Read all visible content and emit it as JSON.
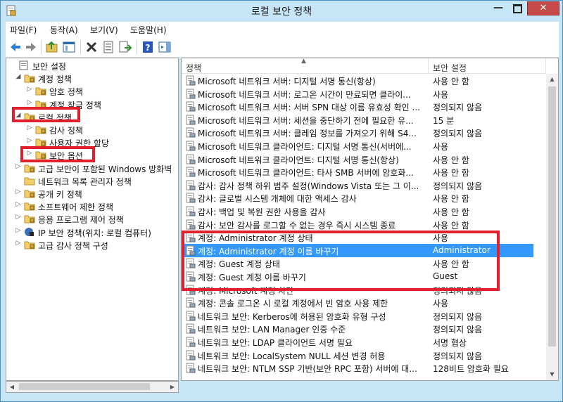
{
  "window": {
    "title": "로컬 보안 정책",
    "min_glyph": "—",
    "close_glyph": "✕"
  },
  "menu": [
    {
      "label": "파일(F)"
    },
    {
      "label": "동작(A)"
    },
    {
      "label": "보기(V)"
    },
    {
      "label": "도움말(H)"
    }
  ],
  "toolbar_icons": [
    "back-icon",
    "forward-icon",
    "up-folder-icon",
    "show-hide-tree-icon",
    "delete-icon",
    "properties-icon",
    "export-list-icon",
    "help-icon",
    "show-hide-action-pane-icon"
  ],
  "tree": [
    {
      "label": "보안 설정",
      "exp": "",
      "icon": "security-settings-icon",
      "level": 0
    },
    {
      "label": "계정 정책",
      "exp": "◢",
      "icon": "folder-icon",
      "level": 1
    },
    {
      "label": "암호 정책",
      "exp": "▷",
      "icon": "folder-icon",
      "level": 2
    },
    {
      "label": "계정 잠금 정책",
      "exp": "▷",
      "icon": "folder-icon",
      "level": 2
    },
    {
      "label": "로컬 정책",
      "exp": "◢",
      "icon": "folder-icon",
      "level": 1
    },
    {
      "label": "감사 정책",
      "exp": "▷",
      "icon": "folder-icon",
      "level": 2
    },
    {
      "label": "사용자 권한 할당",
      "exp": "▷",
      "icon": "folder-icon",
      "level": 2
    },
    {
      "label": "보안 옵션",
      "exp": "▷",
      "icon": "folder-icon",
      "level": 2
    },
    {
      "label": "고급 보안이 포함된 Windows 방화벽",
      "exp": "▷",
      "icon": "folder-icon",
      "level": 1
    },
    {
      "label": "네트워크 목록 관리자 정책",
      "exp": "",
      "icon": "folder-icon",
      "level": 1
    },
    {
      "label": "공개 키 정책",
      "exp": "▷",
      "icon": "folder-icon",
      "level": 1
    },
    {
      "label": "소프트웨어 제한 정책",
      "exp": "▷",
      "icon": "folder-icon",
      "level": 1
    },
    {
      "label": "응용 프로그램 제어 정책",
      "exp": "▷",
      "icon": "folder-icon",
      "level": 1
    },
    {
      "label": "IP 보안 정책(위치: 로컬 컴퓨터)",
      "exp": "▷",
      "icon": "ip-security-icon",
      "level": 1
    },
    {
      "label": "고급 감사 정책 구성",
      "exp": "▷",
      "icon": "folder-icon",
      "level": 1
    }
  ],
  "list": {
    "columns": [
      "정책",
      "보안 설정"
    ],
    "sort_glyph": "▲",
    "selected_index": 13,
    "rows": [
      {
        "name": "Microsoft 네트워크 서버: 디지털 서명 통신(항상)",
        "value": "사용 안 함"
      },
      {
        "name": "Microsoft 네트워크 서버: 로그온 시간이 만료되면 클라이...",
        "value": "사용"
      },
      {
        "name": "Microsoft 네트워크 서버: 서버 SPN 대상 이름 유효성 확인 ...",
        "value": "정의되지 않음"
      },
      {
        "name": "Microsoft 네트워크 서버: 세션을 중단하기 전에 필요한 유...",
        "value": "15 분"
      },
      {
        "name": "Microsoft 네트워크 서버: 클레임 정보를 가져오기 위해 S4...",
        "value": "정의되지 않음"
      },
      {
        "name": "Microsoft 네트워크 클라이언트: 디지털 서명 통신(서버에...",
        "value": "사용"
      },
      {
        "name": "Microsoft 네트워크 클라이언트: 디지털 서명 통신(항상)",
        "value": "사용 안 함"
      },
      {
        "name": "Microsoft 네트워크 클라이언트: 타사 SMB 서버에 암호화...",
        "value": "사용 안 함"
      },
      {
        "name": "감사: 감사 정책 하위 범주 설정(Windows Vista 또는 그 이...",
        "value": "정의되지 않음"
      },
      {
        "name": "감사: 글로벌 시스템 개체에 대한 액세스 감사",
        "value": "사용 안 함"
      },
      {
        "name": "감사: 백업 및 복원 권한 사용을 감사",
        "value": "사용 안 함"
      },
      {
        "name": "감사: 보안 감사를 로그할 수 없는 경우 즉시 시스템 종료",
        "value": "사용 안 함"
      },
      {
        "name": "계정: Administrator 계정 상태",
        "value": "사용"
      },
      {
        "name": "계정: Administrator 계정 이름 바꾸기",
        "value": "Administrator"
      },
      {
        "name": "계정: Guest 계정 상태",
        "value": "사용 안 함"
      },
      {
        "name": "계정: Guest 계정 이름 바꾸기",
        "value": "Guest"
      },
      {
        "name": "계정: Microsoft 계정 차단",
        "value": "정의되지 않음"
      },
      {
        "name": "계정: 콘솔 로그온 시 로컬 계정에서 빈 암호 사용 제한",
        "value": "사용"
      },
      {
        "name": "네트워크 보안: Kerberos에 허용된 암호화 유형 구성",
        "value": "정의되지 않음"
      },
      {
        "name": "네트워크 보안: LAN Manager 인증 수준",
        "value": "정의되지 않음"
      },
      {
        "name": "네트워크 보안: LDAP 클라이언트 서명 필요",
        "value": "서명 협상"
      },
      {
        "name": "네트워크 보안: LocalSystem NULL 세션 변경 허용",
        "value": "정의되지 않음"
      },
      {
        "name": "네트워크 보안: NTLM SSP 기반(보안 RPC 포함) 서버에 대...",
        "value": "128비트 암호화 필요"
      }
    ]
  },
  "colors": {
    "selection": "#3399ff",
    "highlight_box": "#e0202c",
    "frame": "#c6e6f7",
    "close_button": "#c74a4a"
  }
}
